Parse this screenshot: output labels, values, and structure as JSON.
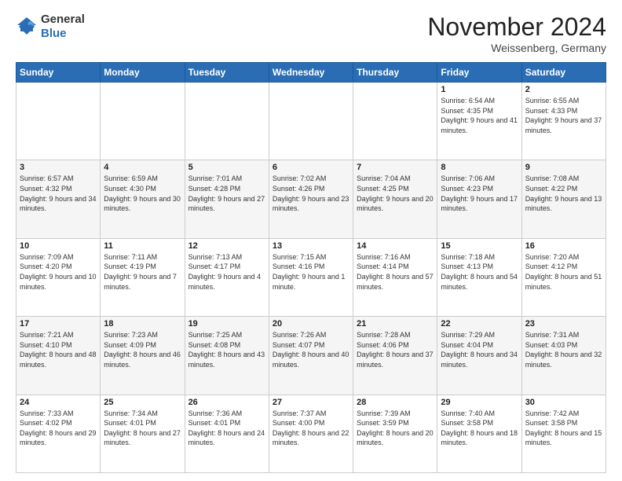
{
  "header": {
    "logo_general": "General",
    "logo_blue": "Blue",
    "month_title": "November 2024",
    "location": "Weissenberg, Germany"
  },
  "days_of_week": [
    "Sunday",
    "Monday",
    "Tuesday",
    "Wednesday",
    "Thursday",
    "Friday",
    "Saturday"
  ],
  "weeks": [
    [
      {
        "day": "",
        "info": ""
      },
      {
        "day": "",
        "info": ""
      },
      {
        "day": "",
        "info": ""
      },
      {
        "day": "",
        "info": ""
      },
      {
        "day": "",
        "info": ""
      },
      {
        "day": "1",
        "info": "Sunrise: 6:54 AM\nSunset: 4:35 PM\nDaylight: 9 hours\nand 41 minutes."
      },
      {
        "day": "2",
        "info": "Sunrise: 6:55 AM\nSunset: 4:33 PM\nDaylight: 9 hours\nand 37 minutes."
      }
    ],
    [
      {
        "day": "3",
        "info": "Sunrise: 6:57 AM\nSunset: 4:32 PM\nDaylight: 9 hours\nand 34 minutes."
      },
      {
        "day": "4",
        "info": "Sunrise: 6:59 AM\nSunset: 4:30 PM\nDaylight: 9 hours\nand 30 minutes."
      },
      {
        "day": "5",
        "info": "Sunrise: 7:01 AM\nSunset: 4:28 PM\nDaylight: 9 hours\nand 27 minutes."
      },
      {
        "day": "6",
        "info": "Sunrise: 7:02 AM\nSunset: 4:26 PM\nDaylight: 9 hours\nand 23 minutes."
      },
      {
        "day": "7",
        "info": "Sunrise: 7:04 AM\nSunset: 4:25 PM\nDaylight: 9 hours\nand 20 minutes."
      },
      {
        "day": "8",
        "info": "Sunrise: 7:06 AM\nSunset: 4:23 PM\nDaylight: 9 hours\nand 17 minutes."
      },
      {
        "day": "9",
        "info": "Sunrise: 7:08 AM\nSunset: 4:22 PM\nDaylight: 9 hours\nand 13 minutes."
      }
    ],
    [
      {
        "day": "10",
        "info": "Sunrise: 7:09 AM\nSunset: 4:20 PM\nDaylight: 9 hours\nand 10 minutes."
      },
      {
        "day": "11",
        "info": "Sunrise: 7:11 AM\nSunset: 4:19 PM\nDaylight: 9 hours\nand 7 minutes."
      },
      {
        "day": "12",
        "info": "Sunrise: 7:13 AM\nSunset: 4:17 PM\nDaylight: 9 hours\nand 4 minutes."
      },
      {
        "day": "13",
        "info": "Sunrise: 7:15 AM\nSunset: 4:16 PM\nDaylight: 9 hours\nand 1 minute."
      },
      {
        "day": "14",
        "info": "Sunrise: 7:16 AM\nSunset: 4:14 PM\nDaylight: 8 hours\nand 57 minutes."
      },
      {
        "day": "15",
        "info": "Sunrise: 7:18 AM\nSunset: 4:13 PM\nDaylight: 8 hours\nand 54 minutes."
      },
      {
        "day": "16",
        "info": "Sunrise: 7:20 AM\nSunset: 4:12 PM\nDaylight: 8 hours\nand 51 minutes."
      }
    ],
    [
      {
        "day": "17",
        "info": "Sunrise: 7:21 AM\nSunset: 4:10 PM\nDaylight: 8 hours\nand 48 minutes."
      },
      {
        "day": "18",
        "info": "Sunrise: 7:23 AM\nSunset: 4:09 PM\nDaylight: 8 hours\nand 46 minutes."
      },
      {
        "day": "19",
        "info": "Sunrise: 7:25 AM\nSunset: 4:08 PM\nDaylight: 8 hours\nand 43 minutes."
      },
      {
        "day": "20",
        "info": "Sunrise: 7:26 AM\nSunset: 4:07 PM\nDaylight: 8 hours\nand 40 minutes."
      },
      {
        "day": "21",
        "info": "Sunrise: 7:28 AM\nSunset: 4:06 PM\nDaylight: 8 hours\nand 37 minutes."
      },
      {
        "day": "22",
        "info": "Sunrise: 7:29 AM\nSunset: 4:04 PM\nDaylight: 8 hours\nand 34 minutes."
      },
      {
        "day": "23",
        "info": "Sunrise: 7:31 AM\nSunset: 4:03 PM\nDaylight: 8 hours\nand 32 minutes."
      }
    ],
    [
      {
        "day": "24",
        "info": "Sunrise: 7:33 AM\nSunset: 4:02 PM\nDaylight: 8 hours\nand 29 minutes."
      },
      {
        "day": "25",
        "info": "Sunrise: 7:34 AM\nSunset: 4:01 PM\nDaylight: 8 hours\nand 27 minutes."
      },
      {
        "day": "26",
        "info": "Sunrise: 7:36 AM\nSunset: 4:01 PM\nDaylight: 8 hours\nand 24 minutes."
      },
      {
        "day": "27",
        "info": "Sunrise: 7:37 AM\nSunset: 4:00 PM\nDaylight: 8 hours\nand 22 minutes."
      },
      {
        "day": "28",
        "info": "Sunrise: 7:39 AM\nSunset: 3:59 PM\nDaylight: 8 hours\nand 20 minutes."
      },
      {
        "day": "29",
        "info": "Sunrise: 7:40 AM\nSunset: 3:58 PM\nDaylight: 8 hours\nand 18 minutes."
      },
      {
        "day": "30",
        "info": "Sunrise: 7:42 AM\nSunset: 3:58 PM\nDaylight: 8 hours\nand 15 minutes."
      }
    ]
  ]
}
